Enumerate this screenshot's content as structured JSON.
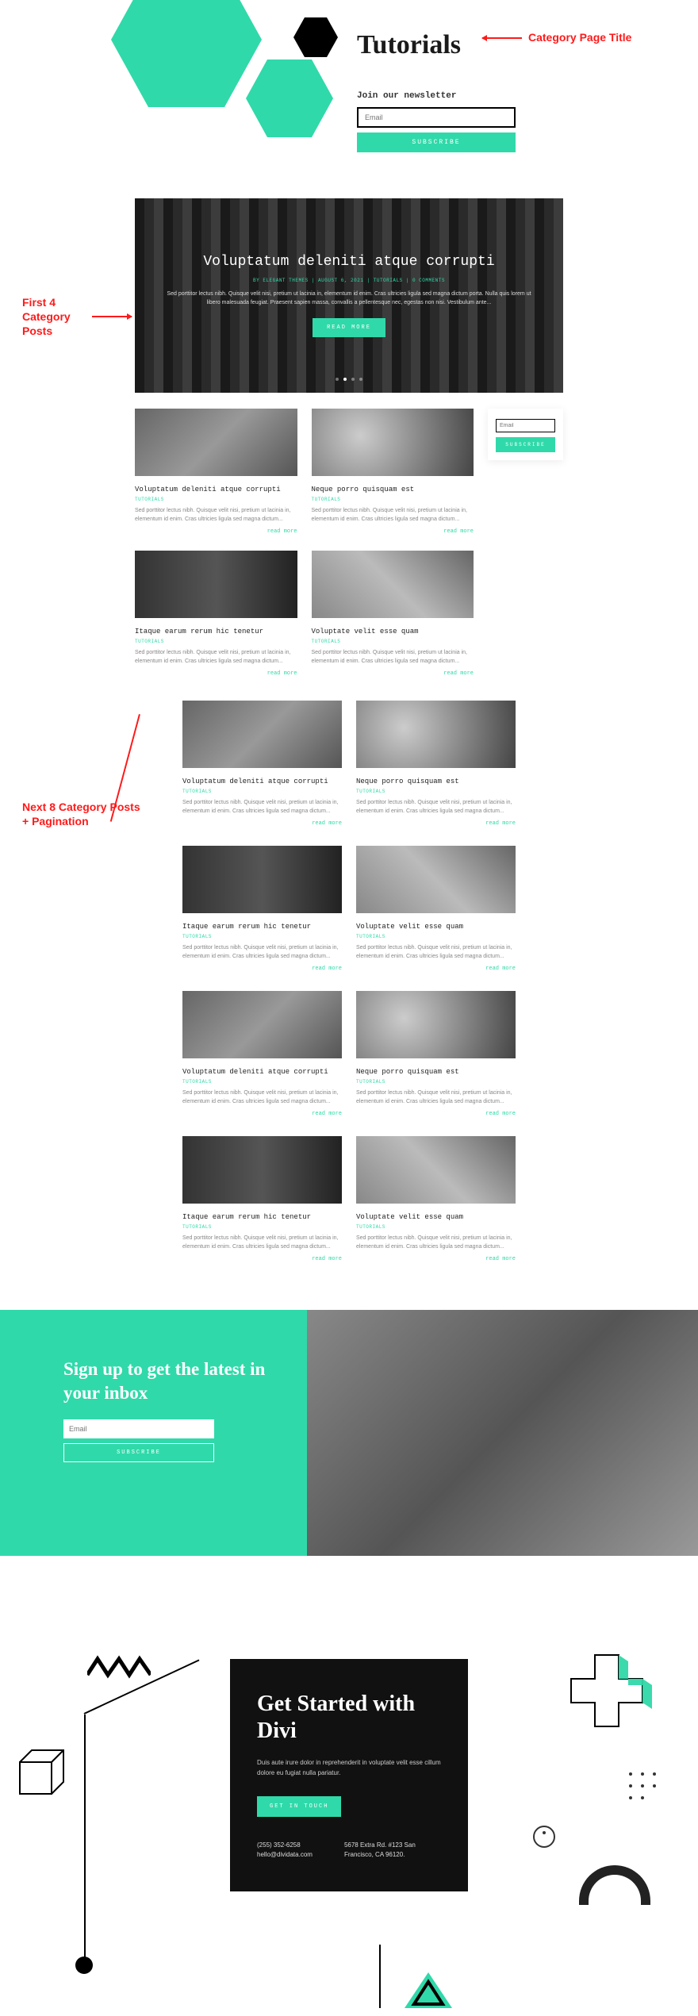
{
  "annotations": {
    "category_title": "Category Page Title",
    "first4": "First 4 Category Posts",
    "next8": "Next 8 Category Posts + Pagination"
  },
  "header": {
    "title": "Tutorials",
    "newsletter_label": "Join our newsletter",
    "email_placeholder": "Email",
    "subscribe": "SUBSCRIBE"
  },
  "hero": {
    "title": "Voluptatum deleniti atque corrupti",
    "meta": "BY ELEGANT THEMES | AUGUST 6, 2021 | TUTORIALS | 0 COMMENTS",
    "excerpt": "Sed porttitor lectus nibh. Quisque velit nisi, pretium ut lacinia in, elementum id enim. Cras ultricies ligula sed magna dictum porta. Nulla quis lorem ut libero malesuada feugiat. Praesent sapien massa, convallis a pellentesque nec, egestas non nisi. Vestibulum ante...",
    "button": "READ MORE"
  },
  "sidebar": {
    "email_placeholder": "Email",
    "subscribe": "SUBSCRIBE"
  },
  "posts": [
    {
      "title": "Voluptatum deleniti atque corrupti",
      "cat": "TUTORIALS",
      "excerpt": "Sed porttitor lectus nibh. Quisque velit nisi, pretium ut lacinia in, elementum id enim. Cras ultricies ligula sed magna dictum...",
      "more": "read more"
    },
    {
      "title": "Neque porro quisquam est",
      "cat": "TUTORIALS",
      "excerpt": "Sed porttitor lectus nibh. Quisque velit nisi, pretium ut lacinia in, elementum id enim. Cras ultricies ligula sed magna dictum...",
      "more": "read more"
    },
    {
      "title": "Itaque earum rerum hic tenetur",
      "cat": "TUTORIALS",
      "excerpt": "Sed porttitor lectus nibh. Quisque velit nisi, pretium ut lacinia in, elementum id enim. Cras ultricies ligula sed magna dictum...",
      "more": "read more"
    },
    {
      "title": "Voluptate velit esse quam",
      "cat": "TUTORIALS",
      "excerpt": "Sed porttitor lectus nibh. Quisque velit nisi, pretium ut lacinia in, elementum id enim. Cras ultricies ligula sed magna dictum...",
      "more": "read more"
    },
    {
      "title": "Voluptatum deleniti atque corrupti",
      "cat": "TUTORIALS",
      "excerpt": "Sed porttitor lectus nibh. Quisque velit nisi, pretium ut lacinia in, elementum id enim. Cras ultricies ligula sed magna dictum...",
      "more": "read more"
    },
    {
      "title": "Neque porro quisquam est",
      "cat": "TUTORIALS",
      "excerpt": "Sed porttitor lectus nibh. Quisque velit nisi, pretium ut lacinia in, elementum id enim. Cras ultricies ligula sed magna dictum...",
      "more": "read more"
    },
    {
      "title": "Itaque earum rerum hic tenetur",
      "cat": "TUTORIALS",
      "excerpt": "Sed porttitor lectus nibh. Quisque velit nisi, pretium ut lacinia in, elementum id enim. Cras ultricies ligula sed magna dictum...",
      "more": "read more"
    },
    {
      "title": "Voluptate velit esse quam",
      "cat": "TUTORIALS",
      "excerpt": "Sed porttitor lectus nibh. Quisque velit nisi, pretium ut lacinia in, elementum id enim. Cras ultricies ligula sed magna dictum...",
      "more": "read more"
    }
  ],
  "signup": {
    "heading": "Sign up to get the latest in your inbox",
    "email_placeholder": "Email",
    "subscribe": "SUBSCRIBE"
  },
  "cta": {
    "heading": "Get Started with Divi",
    "text": "Duis aute irure dolor in reprehenderit in voluptate velit esse cillum dolore eu fugiat nulla pariatur.",
    "button": "GET IN TOUCH",
    "phone": "(255) 352-6258",
    "email": "hello@dividata.com",
    "address": "5678 Extra Rd. #123 San Francisco, CA 96120."
  }
}
